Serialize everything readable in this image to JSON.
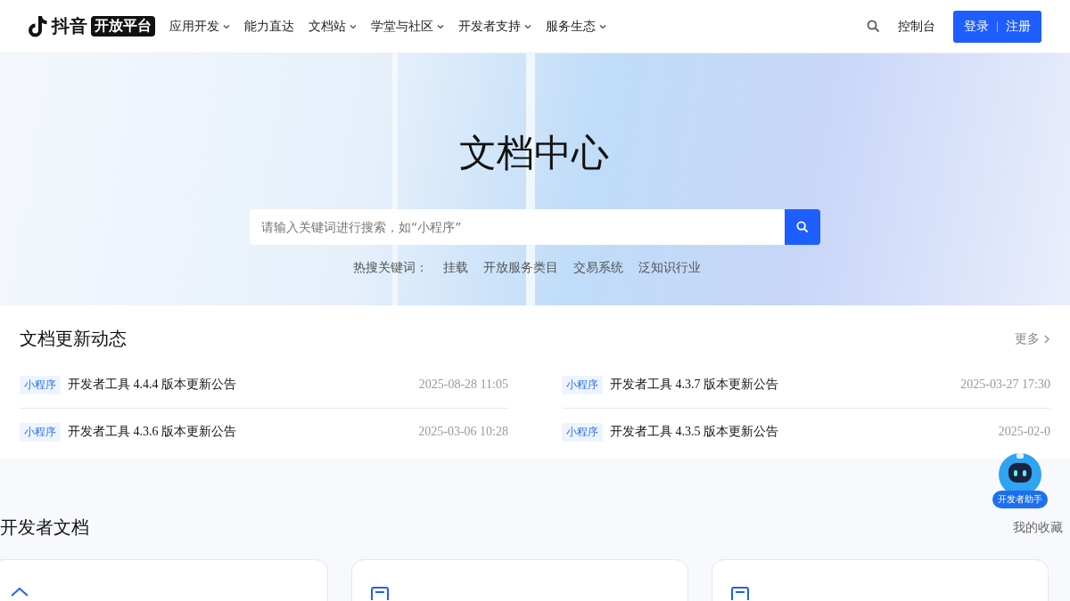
{
  "header": {
    "brand": "抖音",
    "brand_badge": "开放平台",
    "nav": [
      {
        "label": "应用开发",
        "dropdown": true
      },
      {
        "label": "能力直达",
        "dropdown": false
      },
      {
        "label": "文档站",
        "dropdown": true
      },
      {
        "label": "学堂与社区",
        "dropdown": true
      },
      {
        "label": "开发者支持",
        "dropdown": true
      },
      {
        "label": "服务生态",
        "dropdown": true
      }
    ],
    "console": "控制台",
    "login": "登录",
    "register": "注册"
  },
  "hero": {
    "title": "文档中心",
    "search": {
      "placeholder": "请输入关键词进行搜索，如“小程序”"
    },
    "hot_label": "热搜关键词：",
    "hot_keywords": [
      "挂载",
      "开放服务类目",
      "交易系统",
      "泛知识行业"
    ]
  },
  "updates": {
    "title": "文档更新动态",
    "more": "更多",
    "items": [
      {
        "tag": "小程序",
        "title": "开发者工具 4.4.4 版本更新公告",
        "date": "2025-08-28 11:05"
      },
      {
        "tag": "小程序",
        "title": "开发者工具 4.3.7 版本更新公告",
        "date": "2025-03-27 17:30"
      },
      {
        "tag": "小程序",
        "title": "开发者工具 4.3.6 版本更新公告",
        "date": "2025-03-06 10:28"
      },
      {
        "tag": "小程序",
        "title": "开发者工具 4.3.5 版本更新公告",
        "date": "2025-02-0"
      }
    ]
  },
  "assistant": {
    "label": "开发者助手"
  },
  "docs": {
    "title": "开发者文档",
    "favorites": "我的收藏"
  }
}
